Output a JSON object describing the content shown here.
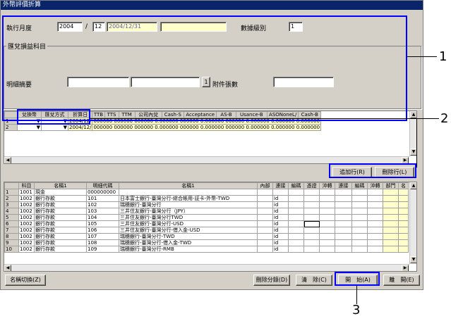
{
  "window": {
    "title": "外幣評價折算"
  },
  "form": {
    "exec_month_label": "執行月度",
    "year": "2004",
    "slash": "/",
    "month": "12",
    "date": "2004/12/31",
    "level_label": "數據級別",
    "level": "1",
    "group_title": "匯兌損益科目",
    "memo_label": "明細摘要",
    "attach_btn": "1",
    "attach_label": "附件張數"
  },
  "upper_grid": {
    "headers": [
      "兌換幣",
      "匯兌方式",
      "折算日",
      "TTB",
      "TTS",
      "TTM",
      "公司內兌",
      "Cash-S",
      "Acceptance",
      "AS-B",
      "Usance-B",
      "ASONoneL/",
      "Cash-B"
    ],
    "rows": [
      {
        "rn": "1",
        "date": "2004/12/",
        "vals": "000000 000000 000000  0.000000 000000  0.000000 000000 0.000000  0.000000 0.000000"
      },
      {
        "rn": "2",
        "date": "2004/12/",
        "vals": "000000 000000 000000  0.000000 000000  0.000000 000000 0.000000  0.000000 0.000000"
      }
    ]
  },
  "buttons": {
    "add_row": "追加行(R)",
    "del_row": "刪除行(L)",
    "name_switch": "名稱切換(Z)",
    "del_entry": "刪除分錄(D)",
    "clear": "清　除(C)",
    "start": "開　始(A)",
    "exit": "離　開(E)"
  },
  "lower_grid": {
    "headers": [
      "科目",
      "名稱1",
      "明細代碼",
      "名稱1",
      "內部",
      "連接",
      "編碼",
      "憑證",
      "沖轉",
      "連接",
      "編碼",
      "沖轉",
      "部門",
      "名"
    ],
    "rows": [
      {
        "rn": "1",
        "acct": "1001",
        "name": "現金",
        "code": "000000000",
        "desc": "",
        "link": ""
      },
      {
        "rn": "2",
        "acct": "1002",
        "name": "銀行存款",
        "code": "101",
        "desc": "日本富士銀行-臺灣分行-綜合帳用-証卡-外幣-TWD",
        "link": "id"
      },
      {
        "rn": "3",
        "acct": "1002",
        "name": "銀行存款",
        "code": "102",
        "desc": "瑞穗銀行-臺灣分行",
        "link": "id"
      },
      {
        "rn": "4",
        "acct": "1002",
        "name": "銀行存款",
        "code": "103",
        "desc": "三井住友銀行-臺灣分行（JPY）",
        "link": "id"
      },
      {
        "rn": "5",
        "acct": "1002",
        "name": "銀行存款",
        "code": "104",
        "desc": "三井住友銀行-臺灣分行TWD",
        "link": "id"
      },
      {
        "rn": "6",
        "acct": "1002",
        "name": "銀行存款",
        "code": "105",
        "desc": "三井住友銀行-臺灣分行-USD",
        "link": "id"
      },
      {
        "rn": "7",
        "acct": "1002",
        "name": "銀行存款",
        "code": "106",
        "desc": "三井住友銀行-臺灣分行-借入金-USD",
        "link": "id"
      },
      {
        "rn": "8",
        "acct": "1002",
        "name": "銀行存款",
        "code": "107",
        "desc": "瑞穗銀行-臺灣分行-TWD",
        "link": "id"
      },
      {
        "rn": "9",
        "acct": "1002",
        "name": "銀行存款",
        "code": "108",
        "desc": "瑞穗銀行-臺灣分行-借入金-TWD",
        "link": "id"
      },
      {
        "rn": "10",
        "acct": "1002",
        "name": "銀行存款",
        "code": "109",
        "desc": "瑞穗銀行-臺灣分行-RMB",
        "link": "id"
      }
    ]
  },
  "callouts": {
    "c1": "1",
    "c2": "2",
    "c3": "3"
  },
  "colors": {
    "callout": "#0000ff",
    "titlebar": "#0a246a",
    "face": "#d4d0c8",
    "highlight": "#ffffcc"
  }
}
